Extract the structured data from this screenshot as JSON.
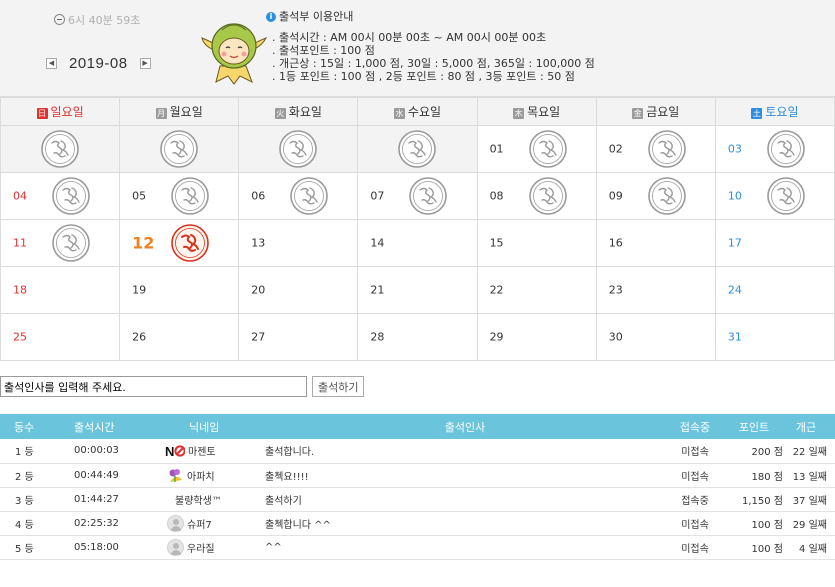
{
  "header": {
    "timer": "6시 40분 59초",
    "month": "2019-08",
    "prev_icon": "chevron-left-icon",
    "next_icon": "chevron-right-icon",
    "info_title": "출석부 이용안내",
    "info_lines": [
      ". 출석시간 : AM 00시 00분 00초 ~ AM 00시 00분 00초",
      ". 출석포인트 : 100 점",
      ". 개근상 : 15일 : 1,000 점,    30일 : 5,000 점,   365일 : 100,000 점",
      ". 1등 포인트 : 100 점   , 2등 포인트 : 80 점   , 3등 포인트 : 50 점"
    ]
  },
  "calendar": {
    "weekdays": [
      {
        "badge": "日",
        "label": "일요일",
        "type": "sun"
      },
      {
        "badge": "月",
        "label": "월요일",
        "type": "wk"
      },
      {
        "badge": "火",
        "label": "화요일",
        "type": "wk"
      },
      {
        "badge": "水",
        "label": "수요일",
        "type": "wk"
      },
      {
        "badge": "木",
        "label": "목요일",
        "type": "wk"
      },
      {
        "badge": "金",
        "label": "금요일",
        "type": "wk"
      },
      {
        "badge": "土",
        "label": "토요일",
        "type": "sat"
      }
    ],
    "weeks": [
      [
        {
          "day": "",
          "stamp": "gray"
        },
        {
          "day": "",
          "stamp": "gray"
        },
        {
          "day": "",
          "stamp": "gray"
        },
        {
          "day": "",
          "stamp": "gray"
        },
        {
          "day": "01",
          "stamp": "gray"
        },
        {
          "day": "02",
          "stamp": "gray"
        },
        {
          "day": "03",
          "stamp": "gray"
        }
      ],
      [
        {
          "day": "04",
          "stamp": "gray"
        },
        {
          "day": "05",
          "stamp": "gray"
        },
        {
          "day": "06",
          "stamp": "gray"
        },
        {
          "day": "07",
          "stamp": "gray"
        },
        {
          "day": "08",
          "stamp": "gray"
        },
        {
          "day": "09",
          "stamp": "gray"
        },
        {
          "day": "10",
          "stamp": "gray"
        }
      ],
      [
        {
          "day": "11",
          "stamp": "gray"
        },
        {
          "day": "12",
          "stamp": "red",
          "today": true
        },
        {
          "day": "13",
          "stamp": ""
        },
        {
          "day": "14",
          "stamp": ""
        },
        {
          "day": "15",
          "stamp": ""
        },
        {
          "day": "16",
          "stamp": ""
        },
        {
          "day": "17",
          "stamp": ""
        }
      ],
      [
        {
          "day": "18",
          "stamp": ""
        },
        {
          "day": "19",
          "stamp": ""
        },
        {
          "day": "20",
          "stamp": ""
        },
        {
          "day": "21",
          "stamp": ""
        },
        {
          "day": "22",
          "stamp": ""
        },
        {
          "day": "23",
          "stamp": ""
        },
        {
          "day": "24",
          "stamp": ""
        }
      ],
      [
        {
          "day": "25",
          "stamp": ""
        },
        {
          "day": "26",
          "stamp": ""
        },
        {
          "day": "27",
          "stamp": ""
        },
        {
          "day": "28",
          "stamp": ""
        },
        {
          "day": "29",
          "stamp": ""
        },
        {
          "day": "30",
          "stamp": ""
        },
        {
          "day": "31",
          "stamp": ""
        }
      ]
    ]
  },
  "greeting": {
    "input_value": "출석인사를 입력해 주세요.",
    "submit_label": "출석하기"
  },
  "ranking": {
    "headers": [
      "등수",
      "출석시간",
      "닉네임",
      "출석인사",
      "접속중",
      "포인트",
      "개근"
    ],
    "rows": [
      {
        "rank": "1 등",
        "time": "00:00:03",
        "icon": "no-badge-icon",
        "nick": "마젠토",
        "msg": "출석합니다.",
        "status": "미접속",
        "points": "200 점",
        "days": "22 일째"
      },
      {
        "rank": "2 등",
        "time": "00:44:49",
        "icon": "flower-icon",
        "nick": "아파치",
        "msg": "출첵요!!!!",
        "status": "미접속",
        "points": "180 점",
        "days": "13 일째"
      },
      {
        "rank": "3 등",
        "time": "01:44:27",
        "icon": "",
        "nick": "불량학생™",
        "msg": "출석하기",
        "status": "접속중",
        "points": "1,150 점",
        "days": "37 일째"
      },
      {
        "rank": "4 등",
        "time": "02:25:32",
        "icon": "avatar-icon",
        "nick": "슈퍼7",
        "msg": "출첵합니다 ^^",
        "status": "미접속",
        "points": "100 점",
        "days": "29 일째"
      },
      {
        "rank": "5 등",
        "time": "05:18:00",
        "icon": "avatar-icon",
        "nick": "우라질",
        "msg": "^^",
        "status": "미접속",
        "points": "100 점",
        "days": "4 일째"
      }
    ]
  },
  "colors": {
    "sunday": "#e0302f",
    "saturday": "#2d8ee0",
    "today": "#f08020",
    "table_header": "#6ac4dc",
    "stamp_gray": "#9a9a9a",
    "stamp_red": "#d8341f"
  }
}
